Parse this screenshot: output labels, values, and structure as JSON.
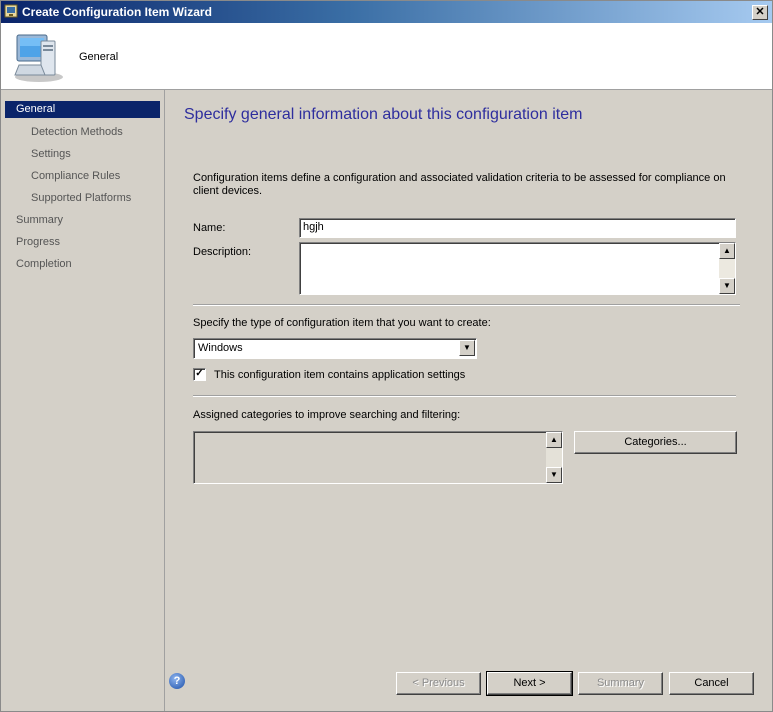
{
  "window": {
    "title": "Create Configuration Item Wizard",
    "close_glyph": "✕"
  },
  "header": {
    "title": "General"
  },
  "sidebar": {
    "items": [
      {
        "label": "General"
      },
      {
        "label": "Detection Methods"
      },
      {
        "label": "Settings"
      },
      {
        "label": "Compliance Rules"
      },
      {
        "label": "Supported Platforms"
      },
      {
        "label": "Summary"
      },
      {
        "label": "Progress"
      },
      {
        "label": "Completion"
      }
    ]
  },
  "main": {
    "heading": "Specify general information about this configuration item",
    "description": "Configuration items define a configuration and associated validation criteria to be assessed for compliance on client devices.",
    "name_label": "Name:",
    "name_value": "hgjh",
    "description_label": "Description:",
    "description_value": "",
    "type_label": "Specify the type of configuration item that you want to create:",
    "type_value": "Windows",
    "app_settings_label": "This configuration item contains application settings",
    "app_settings_checked": true,
    "categories_label": "Assigned categories to improve searching and filtering:",
    "categories_button": "Categories..."
  },
  "footer": {
    "previous": "< Previous",
    "next": "Next >",
    "summary": "Summary",
    "cancel": "Cancel",
    "help_glyph": "?"
  },
  "colors": {
    "title_bar": "#0a246a",
    "heading": "#2e2e9e",
    "selection": "#0a246a",
    "dialog": "#d4d0c8"
  }
}
